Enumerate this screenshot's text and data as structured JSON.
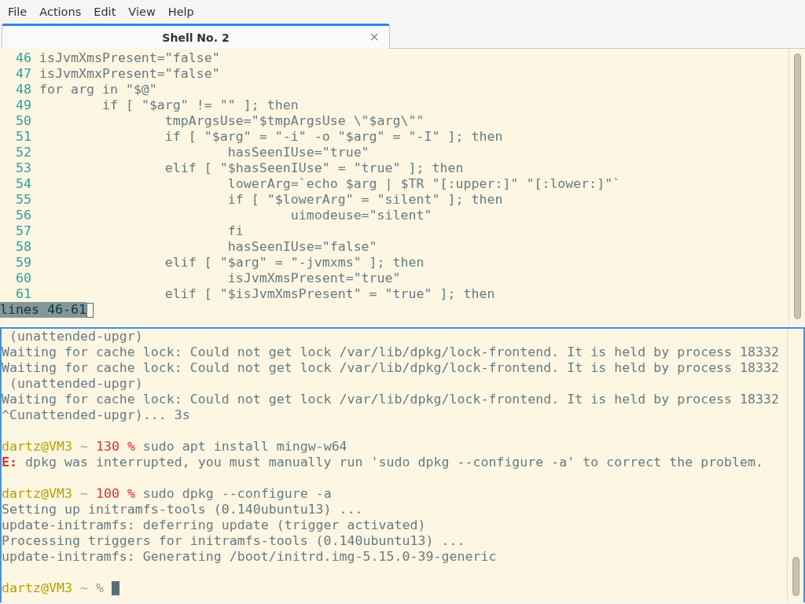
{
  "menu": [
    {
      "label": "File"
    },
    {
      "label": "Actions"
    },
    {
      "label": "Edit"
    },
    {
      "label": "View"
    },
    {
      "label": "Help"
    }
  ],
  "tabs": [
    {
      "title": "Shell No. 2",
      "close": "×",
      "selected": true
    }
  ],
  "pager": {
    "lines": [
      {
        "number": "46",
        "code": "isJvmXmsPresent=\"false\""
      },
      {
        "number": "47",
        "code": "isJvmXmxPresent=\"false\""
      },
      {
        "number": "48",
        "code": "for arg in \"$@\""
      },
      {
        "number": "49",
        "code": "\tif [ \"$arg\" != \"\" ]; then"
      },
      {
        "number": "50",
        "code": "\t\ttmpArgsUse=\"$tmpArgsUse \\\"$arg\\\"\""
      },
      {
        "number": "51",
        "code": "\t\tif [ \"$arg\" = \"-i\" -o \"$arg\" = \"-I\" ]; then"
      },
      {
        "number": "52",
        "code": "\t\t\thasSeenIUse=\"true\""
      },
      {
        "number": "53",
        "code": "\t\telif [ \"$hasSeenIUse\" = \"true\" ]; then"
      },
      {
        "number": "54",
        "code": "\t\t\tlowerArg=`echo $arg | $TR \"[:upper:]\" \"[:lower:]\"`"
      },
      {
        "number": "55",
        "code": "\t\t\tif [ \"$lowerArg\" = \"silent\" ]; then"
      },
      {
        "number": "56",
        "code": "\t\t\t\tuimodeuse=\"silent\""
      },
      {
        "number": "57",
        "code": "\t\t\tfi"
      },
      {
        "number": "58",
        "code": "\t\t\thasSeenIUse=\"false\""
      },
      {
        "number": "59",
        "code": "\t\telif [ \"$arg\" = \"-jvmxms\" ]; then"
      },
      {
        "number": "60",
        "code": "\t\t\tisJvmXmsPresent=\"true\""
      },
      {
        "number": "61",
        "code": "\t\telif [ \"$isJvmXmsPresent\" = \"true\" ]; then"
      }
    ],
    "status": "lines 46-61"
  },
  "terminal": {
    "lines": [
      {
        "kind": "output",
        "text": " (unattended-upgr)"
      },
      {
        "kind": "output",
        "text": "Waiting for cache lock: Could not get lock /var/lib/dpkg/lock-frontend. It is held by process 18332"
      },
      {
        "kind": "output",
        "text": "Waiting for cache lock: Could not get lock /var/lib/dpkg/lock-frontend. It is held by process 18332"
      },
      {
        "kind": "output",
        "text": " (unattended-upgr)"
      },
      {
        "kind": "output",
        "text": "Waiting for cache lock: Could not get lock /var/lib/dpkg/lock-frontend. It is held by process 18332"
      },
      {
        "kind": "output",
        "text": "^Cunattended-upgr)... 3s"
      },
      {
        "kind": "blank"
      },
      {
        "kind": "prompt",
        "user": "dartz@VM3",
        "dir": "~",
        "status": "130",
        "symbol": "%",
        "command": "sudo apt install mingw-w64",
        "cursor": false
      },
      {
        "kind": "error",
        "label": "E:",
        "text": "dpkg was interrupted, you must manually run 'sudo dpkg --configure -a' to correct the problem."
      },
      {
        "kind": "blank"
      },
      {
        "kind": "prompt",
        "user": "dartz@VM3",
        "dir": "~",
        "status": "100",
        "symbol": "%",
        "command": "sudo dpkg --configure -a",
        "cursor": false
      },
      {
        "kind": "output",
        "text": "Setting up initramfs-tools (0.140ubuntu13) ..."
      },
      {
        "kind": "output",
        "text": "update-initramfs: deferring update (trigger activated)"
      },
      {
        "kind": "output",
        "text": "Processing triggers for initramfs-tools (0.140ubuntu13) ..."
      },
      {
        "kind": "output",
        "text": "update-initramfs: Generating /boot/initrd.img-5.15.0-39-generic"
      },
      {
        "kind": "blank"
      },
      {
        "kind": "prompt",
        "user": "dartz@VM3",
        "dir": "~",
        "symbol": "%",
        "cursor": true
      }
    ]
  }
}
